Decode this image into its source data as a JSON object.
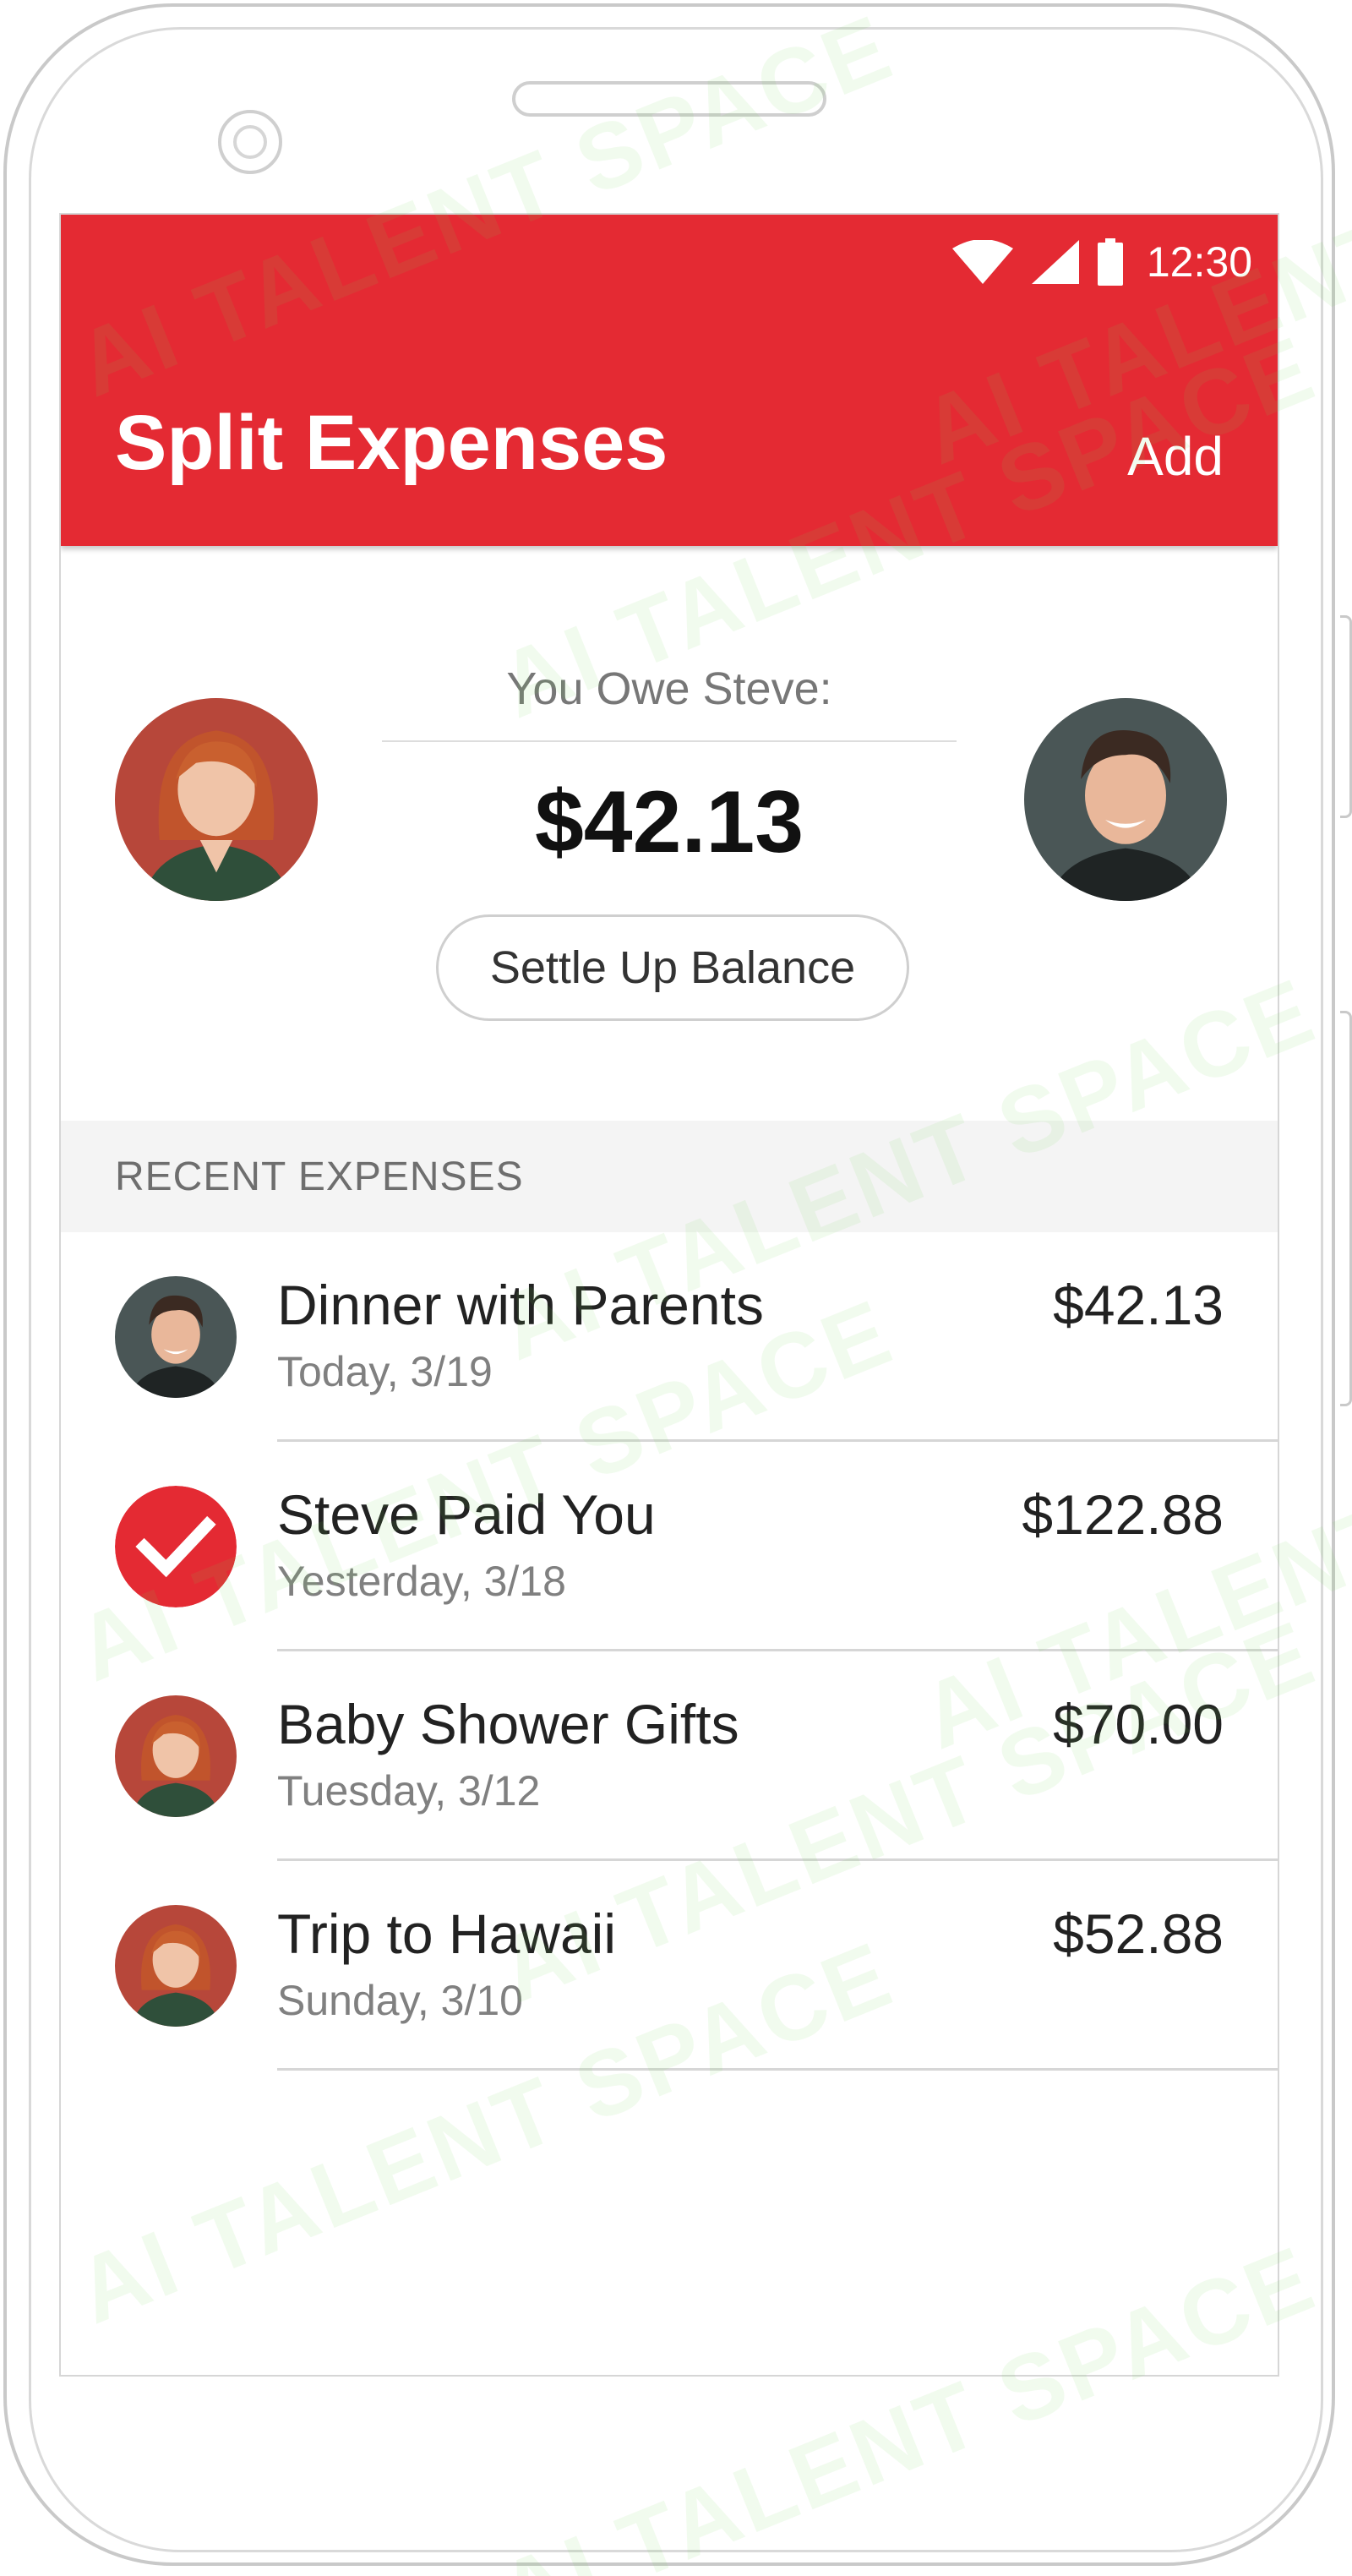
{
  "status_bar": {
    "time": "12:30",
    "icons": [
      "wifi-icon",
      "cell-signal-icon",
      "battery-icon"
    ]
  },
  "app_bar": {
    "title": "Split Expenses",
    "add_label": "Add"
  },
  "balance": {
    "owe_label": "You Owe Steve:",
    "amount": "$42.13",
    "settle_label": "Settle Up Balance"
  },
  "recent": {
    "header": "RECENT EXPENSES",
    "items": [
      {
        "title": "Dinner with Parents",
        "date": "Today, 3/19",
        "amount": "$42.13",
        "avatar": "avatar-steve"
      },
      {
        "title": "Steve Paid You",
        "date": "Yesterday, 3/18",
        "amount": "$122.88",
        "avatar": "checkmark-icon"
      },
      {
        "title": "Baby Shower Gifts",
        "date": "Tuesday, 3/12",
        "amount": "$70.00",
        "avatar": "avatar-user"
      },
      {
        "title": "Trip to Hawaii",
        "date": "Sunday, 3/10",
        "amount": "$52.88",
        "avatar": "avatar-user"
      }
    ]
  },
  "watermark": "AI TALENT SPACE",
  "colors": {
    "accent": "#e42a33",
    "section_bg": "#f4f4f4",
    "divider": "#d6d6d6"
  }
}
